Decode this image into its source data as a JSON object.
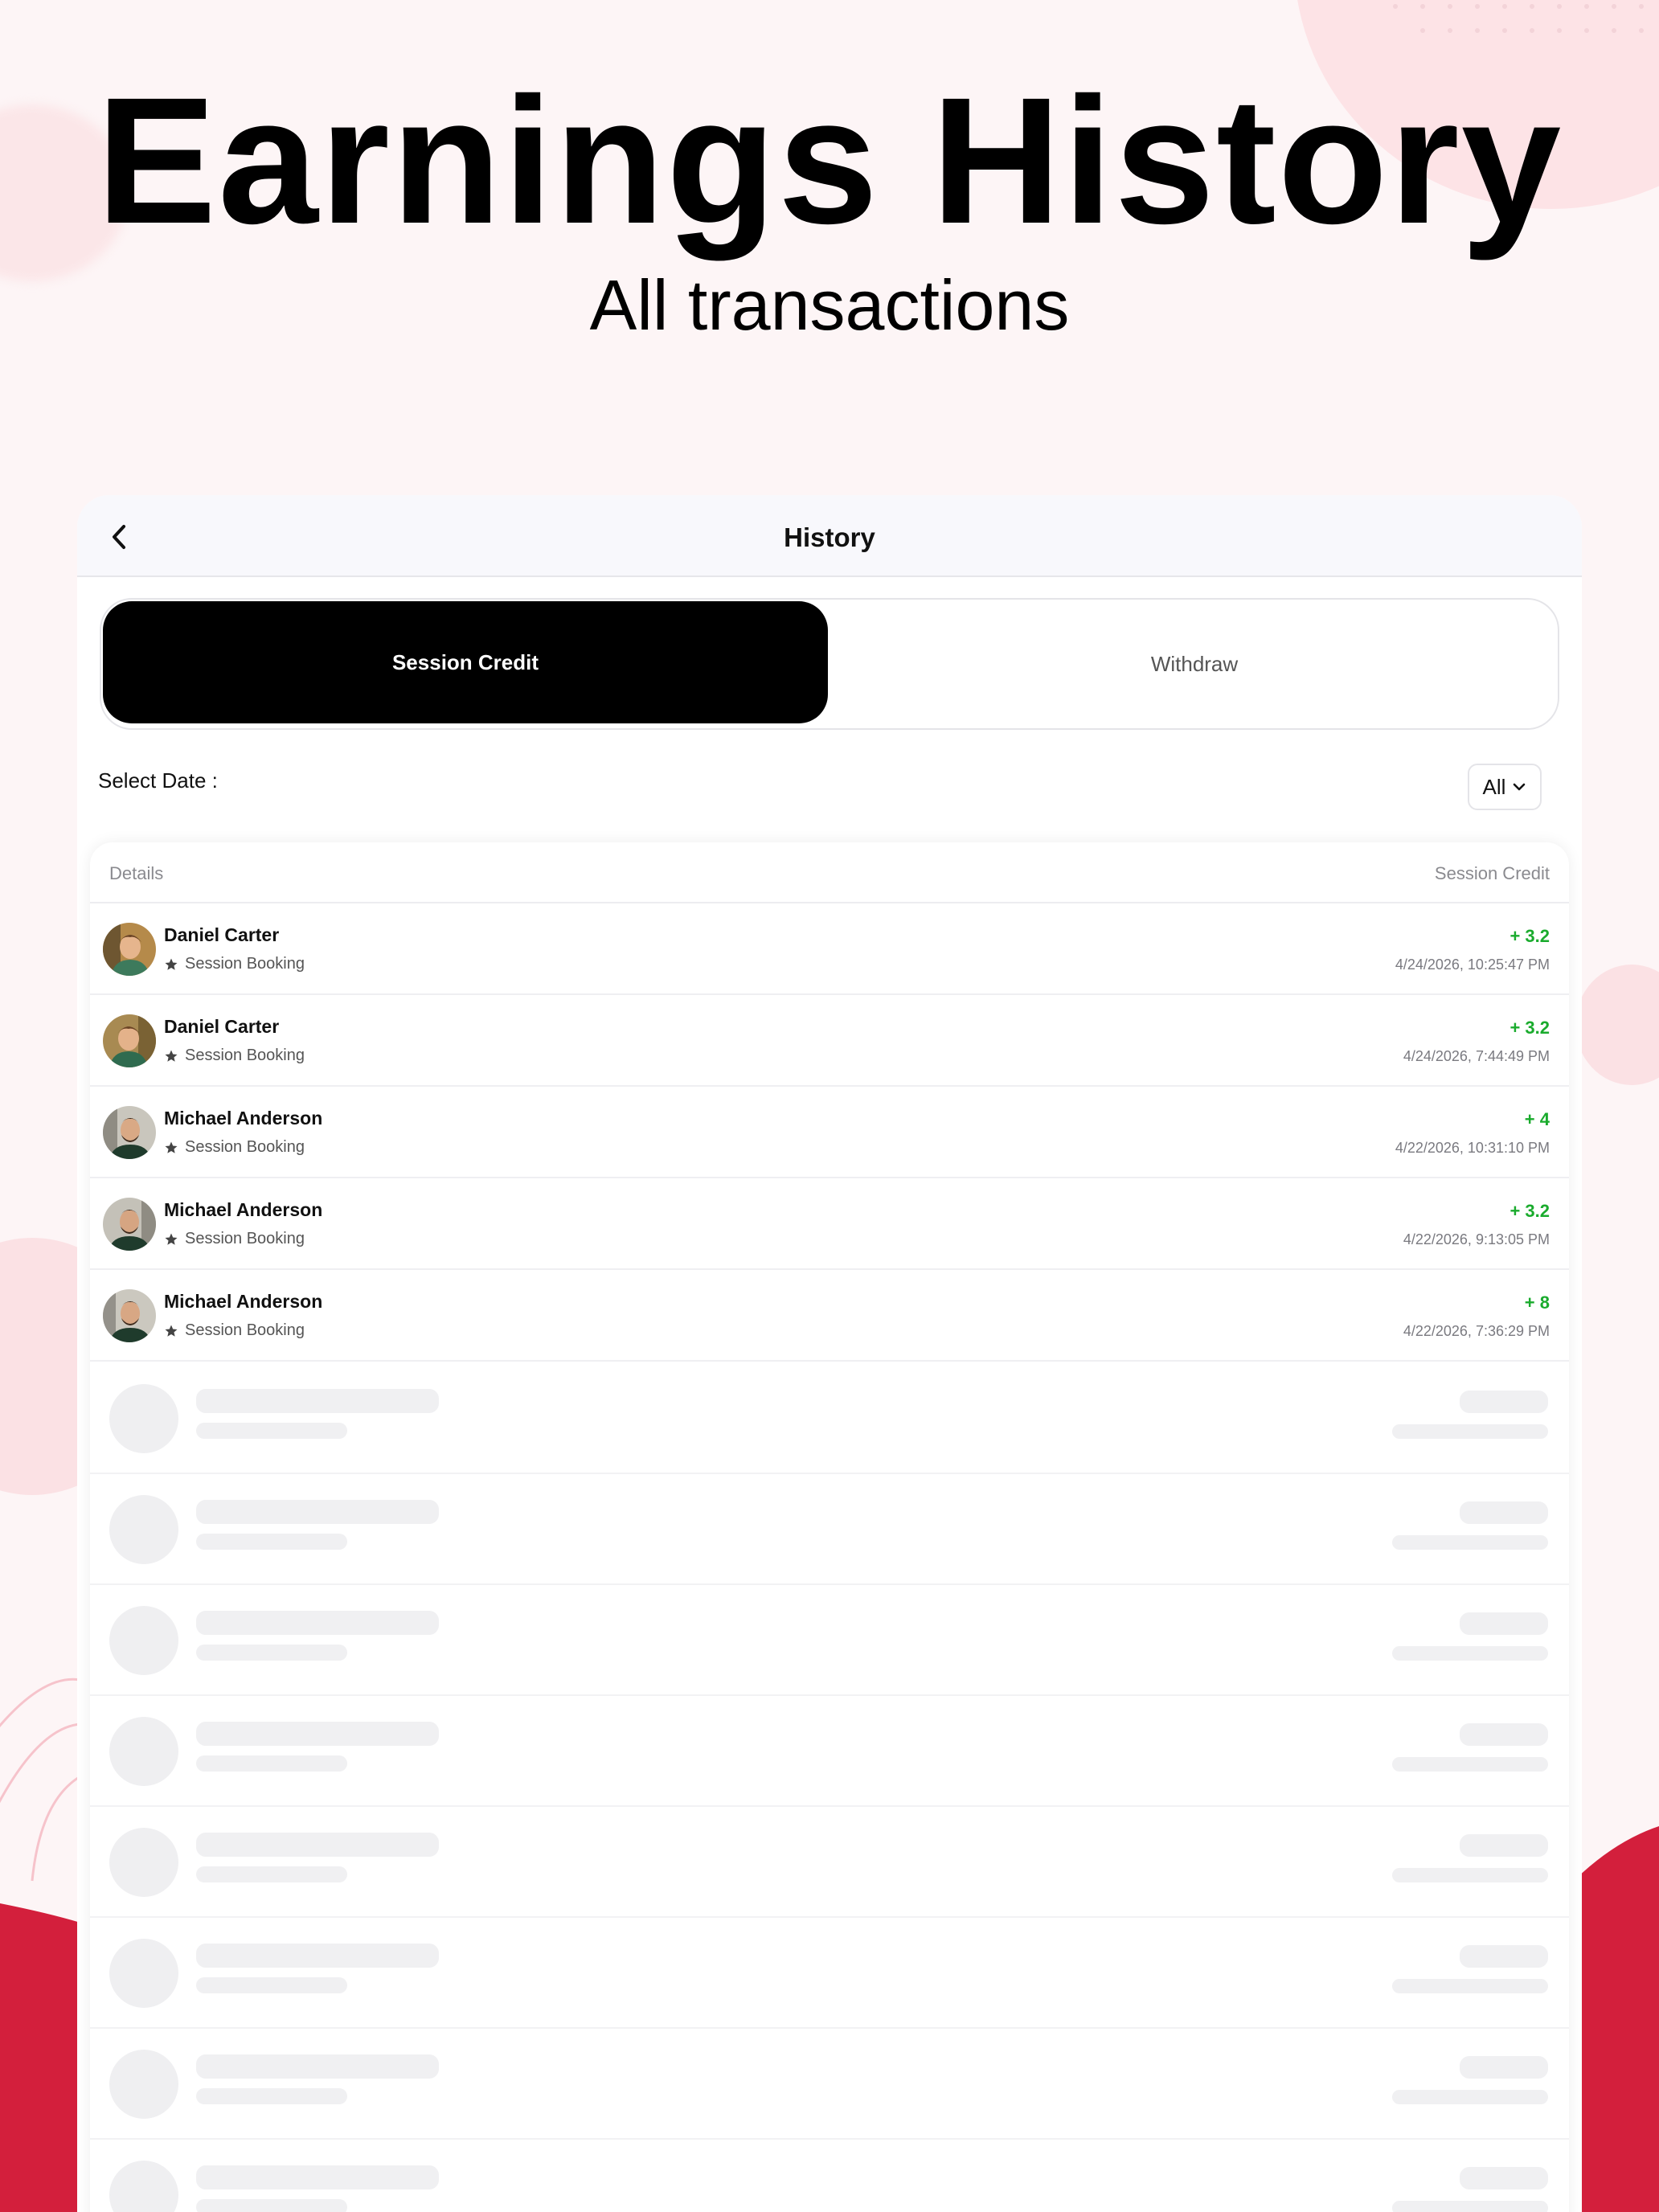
{
  "hero": {
    "title": "Earnings History",
    "subtitle": "All transactions"
  },
  "app": {
    "header_title": "History",
    "back_icon": "chevron-left-icon",
    "tabs": [
      {
        "label": "Session Credit",
        "active": true
      },
      {
        "label": "Withdraw",
        "active": false
      }
    ],
    "date_filter": {
      "label": "Select Date :",
      "value": "All",
      "icon": "chevron-down-icon"
    },
    "list": {
      "col_details": "Details",
      "col_credit": "Session Credit",
      "rows": [
        {
          "name": "Daniel Carter",
          "type": "Session Booking",
          "amount": "+ 3.2",
          "datetime": "4/24/2026, 10:25:47 PM"
        },
        {
          "name": "Daniel Carter",
          "type": "Session Booking",
          "amount": "+ 3.2",
          "datetime": "4/24/2026, 7:44:49 PM"
        },
        {
          "name": "Michael Anderson",
          "type": "Session Booking",
          "amount": "+ 4",
          "datetime": "4/22/2026, 10:31:10 PM"
        },
        {
          "name": "Michael Anderson",
          "type": "Session Booking",
          "amount": "+ 3.2",
          "datetime": "4/22/2026, 9:13:05 PM"
        },
        {
          "name": "Michael Anderson",
          "type": "Session Booking",
          "amount": "+ 8",
          "datetime": "4/22/2026, 7:36:29 PM"
        }
      ]
    }
  },
  "colors": {
    "accent_red": "#d31f3c",
    "credit_green": "#1aab2d",
    "active_tab": "#000000"
  }
}
